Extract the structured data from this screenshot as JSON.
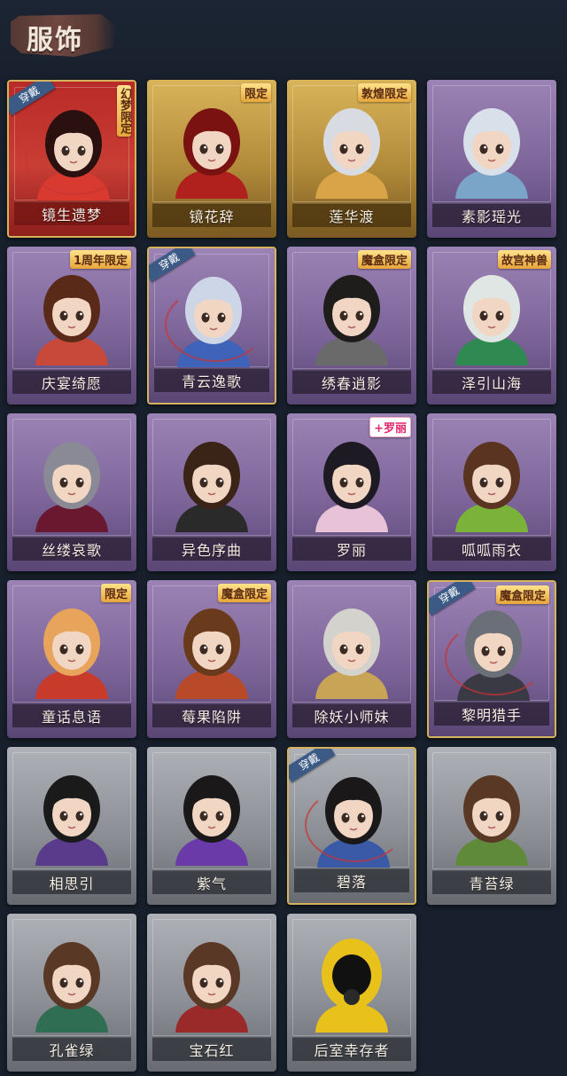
{
  "page": {
    "title": "服饰"
  },
  "colors": {
    "gold": "#d6b25d",
    "badge": "#3b5b86",
    "equip_ring": "#c83434"
  },
  "badge_text": "穿戴",
  "cards": [
    {
      "label": "镜生遗梦",
      "tag": "幻梦限定",
      "tag_style": "vertical",
      "style": "red",
      "equipped": true,
      "hair": "#2b1010",
      "accent": "#d83a30",
      "icon": "bride-portrait"
    },
    {
      "label": "镜花辞",
      "tag": "限定",
      "tag_style": "normal",
      "style": "gold",
      "equipped": false,
      "hair": "#7a1212",
      "accent": "#b0201c",
      "icon": "red-hood-portrait"
    },
    {
      "label": "莲华渡",
      "tag": "敦煌限定",
      "tag_style": "normal",
      "style": "gold",
      "equipped": false,
      "hair": "#d9dbe2",
      "accent": "#d8a447",
      "icon": "dunhuang-portrait"
    },
    {
      "label": "素影瑶光",
      "tag": "",
      "tag_style": "none",
      "style": "purple",
      "equipped": false,
      "hair": "#d8e0ea",
      "accent": "#7aa4c8",
      "icon": "white-hair-portrait"
    },
    {
      "label": "庆宴绮愿",
      "tag": "1周年限定",
      "tag_style": "normal",
      "style": "purple",
      "equipped": false,
      "hair": "#5a2a18",
      "accent": "#c8483a",
      "icon": "cake-portrait"
    },
    {
      "label": "青云逸歌",
      "tag": "",
      "tag_style": "none",
      "style": "purple",
      "equipped": true,
      "hair": "#cdd6e6",
      "accent": "#3e63b8",
      "icon": "blue-scholar-portrait"
    },
    {
      "label": "绣春逍影",
      "tag": "魔盒限定",
      "tag_style": "normal",
      "style": "purple",
      "equipped": false,
      "hair": "#1f1c1c",
      "accent": "#6a6a6a",
      "icon": "swordsman-portrait"
    },
    {
      "label": "泽引山海",
      "tag": "故宫神兽",
      "tag_style": "normal",
      "style": "purple",
      "equipped": false,
      "hair": "#dfe6e3",
      "accent": "#2f8a52",
      "icon": "mythic-beast-portrait"
    },
    {
      "label": "丝缕哀歌",
      "tag": "",
      "tag_style": "none",
      "style": "purple",
      "equipped": false,
      "hair": "#8a8a96",
      "accent": "#6a1830",
      "icon": "gothic-portrait"
    },
    {
      "label": "异色序曲",
      "tag": "",
      "tag_style": "none",
      "style": "purple",
      "equipped": false,
      "hair": "#3a2418",
      "accent": "#2a2a2a",
      "icon": "top-hat-portrait"
    },
    {
      "label": "罗丽",
      "tag": "+罗丽",
      "tag_style": "pink",
      "style": "purple",
      "equipped": false,
      "hair": "#1d1a24",
      "accent": "#e8c2d6",
      "icon": "doll-portrait"
    },
    {
      "label": "呱呱雨衣",
      "tag": "",
      "tag_style": "none",
      "style": "purple",
      "equipped": false,
      "hair": "#5a3420",
      "accent": "#7ab23a",
      "icon": "frog-raincoat-portrait"
    },
    {
      "label": "童话息语",
      "tag": "限定",
      "tag_style": "normal",
      "style": "purple",
      "equipped": false,
      "hair": "#e8a45a",
      "accent": "#c83a2a",
      "icon": "fairytale-portrait"
    },
    {
      "label": "莓果陷阱",
      "tag": "魔盒限定",
      "tag_style": "normal",
      "style": "purple",
      "equipped": false,
      "hair": "#6a3a1c",
      "accent": "#b84a2a",
      "icon": "berry-portrait"
    },
    {
      "label": "除妖小师妹",
      "tag": "",
      "tag_style": "none",
      "style": "purple",
      "equipped": false,
      "hair": "#d4d2cc",
      "accent": "#c8a456",
      "icon": "blindfold-portrait"
    },
    {
      "label": "黎明猎手",
      "tag": "魔盒限定",
      "tag_style": "normal",
      "style": "purple",
      "equipped": true,
      "hair": "#6a6f78",
      "accent": "#3a3a44",
      "icon": "hunter-portrait"
    },
    {
      "label": "相思引",
      "tag": "",
      "tag_style": "none",
      "style": "gray",
      "equipped": false,
      "hair": "#1a1a1a",
      "accent": "#5a3a8a",
      "icon": "headdress-portrait"
    },
    {
      "label": "紫气",
      "tag": "",
      "tag_style": "none",
      "style": "gray",
      "equipped": false,
      "hair": "#1a1818",
      "accent": "#6a3aa8",
      "icon": "braid-boy-purple-portrait"
    },
    {
      "label": "碧落",
      "tag": "",
      "tag_style": "none",
      "style": "gray",
      "equipped": true,
      "hair": "#1a1818",
      "accent": "#3a5aa8",
      "icon": "braid-boy-blue-portrait"
    },
    {
      "label": "青苔绿",
      "tag": "",
      "tag_style": "none",
      "style": "gray",
      "equipped": false,
      "hair": "#5a3826",
      "accent": "#5f8a3a",
      "icon": "girl-green-portrait"
    },
    {
      "label": "孔雀绿",
      "tag": "",
      "tag_style": "none",
      "style": "gray",
      "equipped": false,
      "hair": "#5a3826",
      "accent": "#2f6e52",
      "icon": "girl-teal-portrait"
    },
    {
      "label": "宝石红",
      "tag": "",
      "tag_style": "none",
      "style": "gray",
      "equipped": false,
      "hair": "#5a3826",
      "accent": "#9a2a2a",
      "icon": "girl-red-portrait"
    },
    {
      "label": "后室幸存者",
      "tag": "",
      "tag_style": "none",
      "style": "gray",
      "equipped": false,
      "hair": "#e8c21a",
      "accent": "#e8c21a",
      "icon": "hazmat-portrait"
    }
  ]
}
